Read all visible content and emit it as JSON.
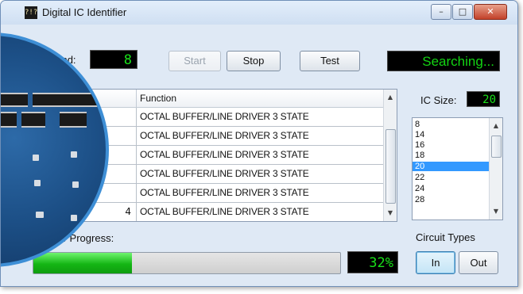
{
  "window": {
    "title": "Digital IC Identifier",
    "icon_glyph": "?!?",
    "controls": {
      "minimize": "–",
      "maximize": "□",
      "close": "✕"
    }
  },
  "toolbar": {
    "found_label": "ound:",
    "found_value": "8",
    "start_label": "Start",
    "stop_label": "Stop",
    "test_label": "Test",
    "status": "Searching..."
  },
  "table": {
    "header_function": "Function",
    "rows": [
      {
        "id": "",
        "function": "OCTAL BUFFER/LINE DRIVER 3 STATE"
      },
      {
        "id": "",
        "function": "OCTAL BUFFER/LINE DRIVER 3 STATE"
      },
      {
        "id": "",
        "function": "OCTAL BUFFER/LINE DRIVER 3 STATE"
      },
      {
        "id": "",
        "function": "OCTAL BUFFER/LINE DRIVER 3 STATE"
      },
      {
        "id": "",
        "function": "OCTAL BUFFER/LINE DRIVER 3 STATE"
      },
      {
        "id": "4",
        "function": "OCTAL BUFFER/LINE DRIVER 3 STATE"
      }
    ]
  },
  "ic_size": {
    "label": "IC Size:",
    "value": "20",
    "options": [
      "8",
      "14",
      "16",
      "18",
      "20",
      "22",
      "24",
      "28"
    ],
    "selected": "20"
  },
  "progress": {
    "label": "ifier Progress:",
    "percent": 32,
    "percent_text": "32%"
  },
  "circuit_types": {
    "label": "Circuit Types",
    "in_label": "In",
    "out_label": "Out",
    "active": "In"
  },
  "icons": [
    "app-icon",
    "minimize-icon",
    "maximize-icon",
    "close-icon",
    "scroll-up-icon",
    "scroll-down-icon"
  ],
  "colors": {
    "lcd_text": "#19e019",
    "progress_fill": "#14b614",
    "selection": "#3399ff",
    "close_button": "#c2412a"
  }
}
